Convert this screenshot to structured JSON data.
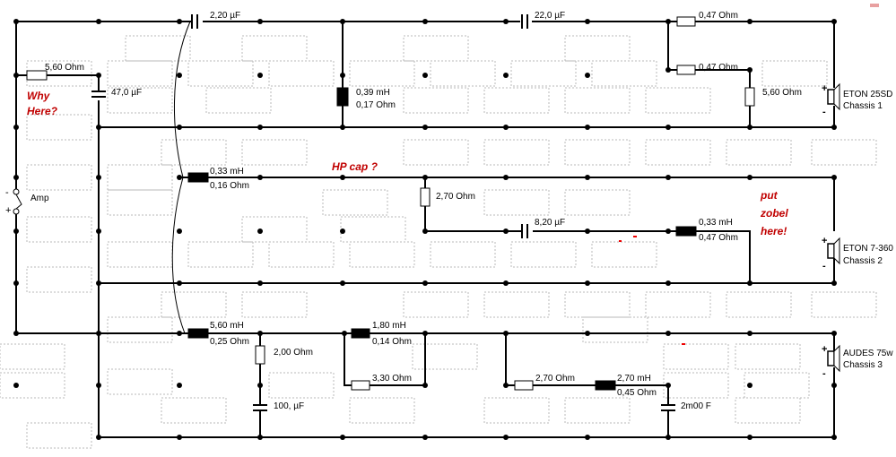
{
  "caps": {
    "c1": "2,20 µF",
    "c2": "22,0 µF",
    "c3": "47,0 µF",
    "c4": "8,20 µF",
    "c5": "100, µF",
    "c6": "2m00 F"
  },
  "resistors": {
    "r1": "0,47 Ohm",
    "r2": "0,47 Ohm",
    "r3": "5,60 Ohm",
    "r4": "5,60 Ohm",
    "r5": "2,70 Ohm",
    "r6": "2,00 Ohm",
    "r7": "3,30 Ohm",
    "r8": "2,70 Ohm"
  },
  "inductors": {
    "l1": {
      "value": "0,39 mH",
      "dcr": "0,17 Ohm"
    },
    "l2": {
      "value": "0,33 mH",
      "dcr": "0,16 Ohm"
    },
    "l3": {
      "value": "0,33 mH",
      "dcr": "0,47 Ohm"
    },
    "l4": {
      "value": "5,60 mH",
      "dcr": "0,25 Ohm"
    },
    "l5": {
      "value": "1,80 mH",
      "dcr": "0,14 Ohm"
    },
    "l6": {
      "value": "2,70 mH",
      "dcr": "0,45 Ohm"
    }
  },
  "speakers": {
    "s1": {
      "name": "ETON 25SD",
      "chassis": "Chassis 1"
    },
    "s2": {
      "name": "ETON 7-360",
      "chassis": "Chassis 2"
    },
    "s3": {
      "name": "AUDES 75w",
      "chassis": "Chassis 3"
    }
  },
  "amp": {
    "label": "Amp"
  },
  "notes": {
    "why1": "Why",
    "why2": "Here?",
    "hp": "HP cap ?",
    "zobel1": "put",
    "zobel2": "zobel",
    "zobel3": "here!"
  }
}
